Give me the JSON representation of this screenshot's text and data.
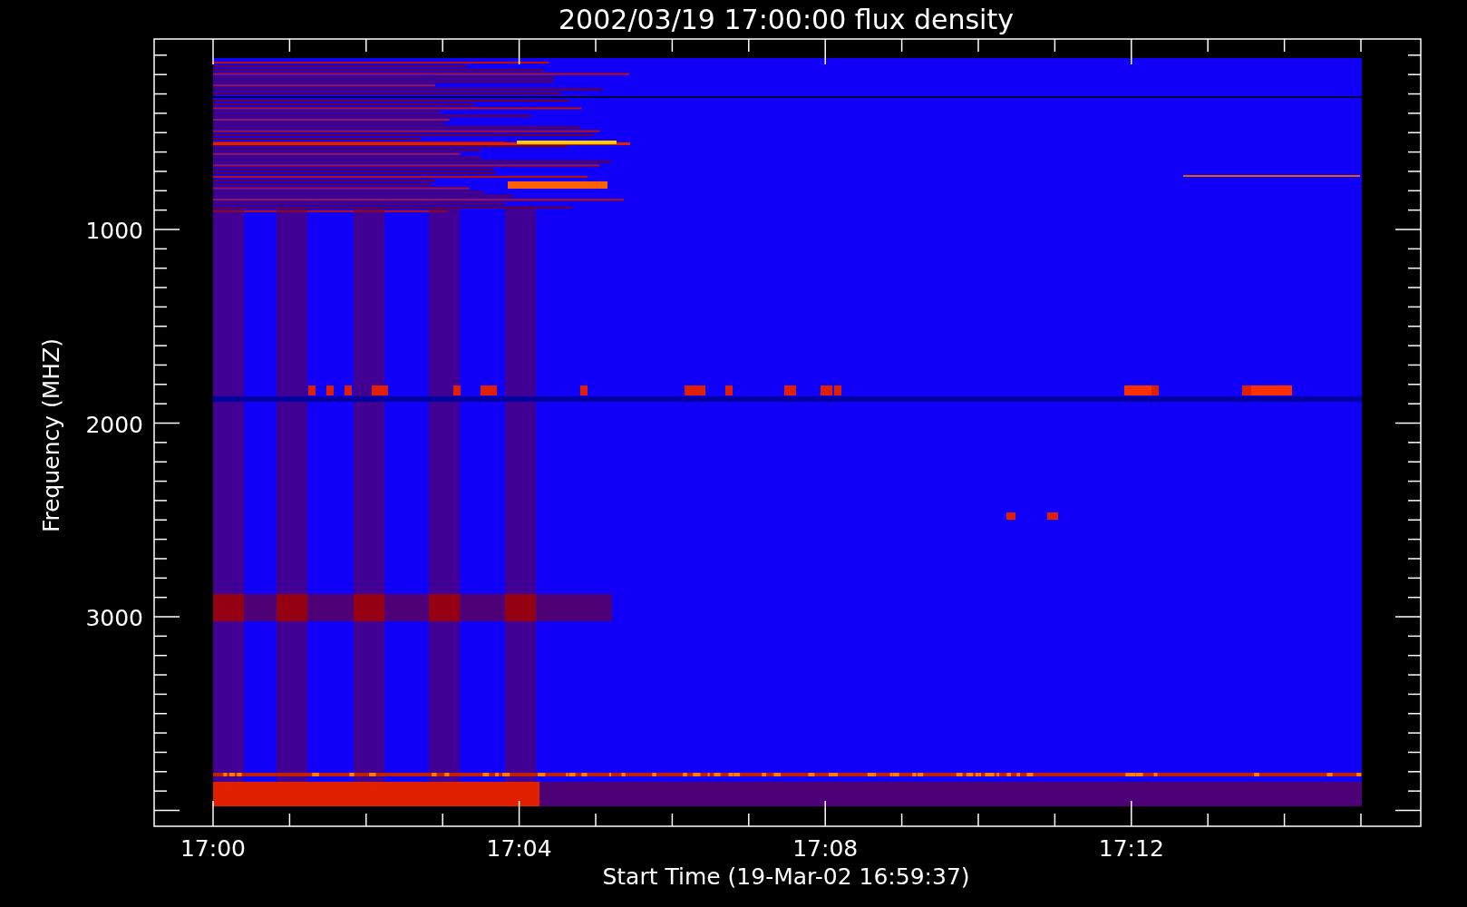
{
  "title": "2002/03/19 17:00:00 flux density",
  "plot": {
    "y_axis_label": "Frequency (MHZ)",
    "y_tick_labels": [
      "1000",
      "2000",
      "3000"
    ],
    "x_tick_labels": [
      "17:00",
      "17:04",
      "17:08",
      "17:12"
    ],
    "x_axis_label": "Start Time (19-Mar-02 16:59:37)"
  }
}
